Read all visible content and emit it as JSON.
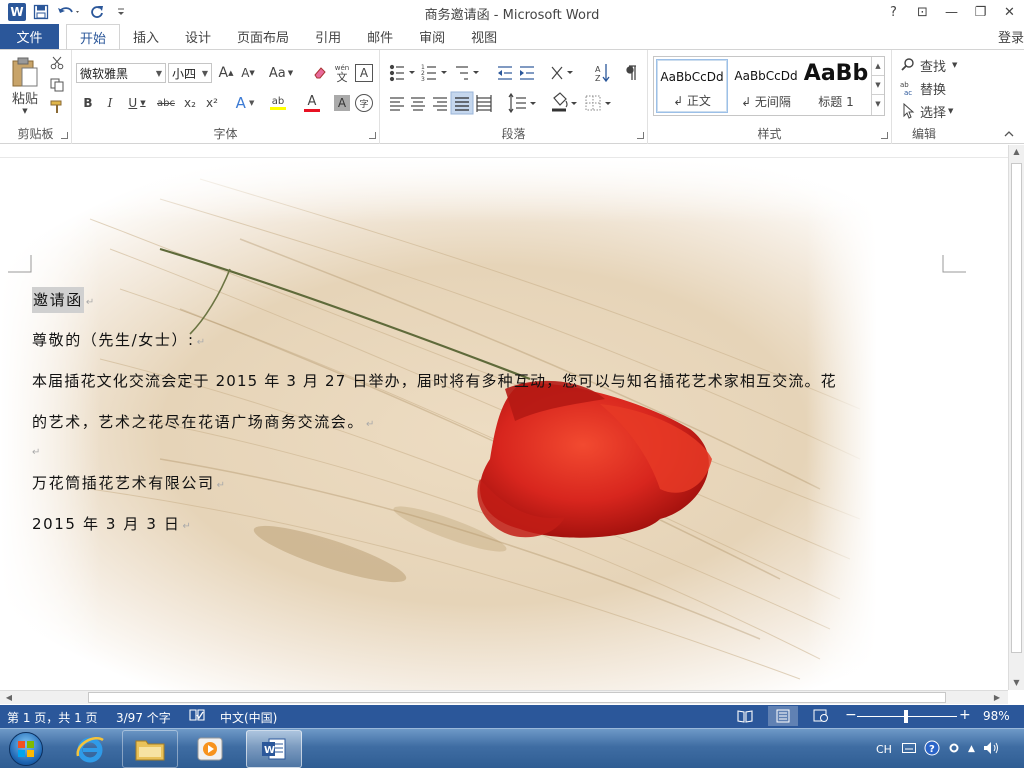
{
  "window": {
    "title": "商务邀请函 - Microsoft Word",
    "controls": [
      "?",
      "⊡",
      "—",
      "❐",
      "✕"
    ],
    "login": "登录"
  },
  "qat": {
    "logo": "W"
  },
  "tabs": {
    "file": "文件",
    "items": [
      "开始",
      "插入",
      "设计",
      "页面布局",
      "引用",
      "邮件",
      "审阅",
      "视图"
    ]
  },
  "ribbon": {
    "clipboard": {
      "label": "剪贴板",
      "paste": "粘贴"
    },
    "font": {
      "label": "字体",
      "name": "微软雅黑",
      "size": "小四",
      "grow": "A",
      "shrink": "A",
      "case": "Aa",
      "phonetic": "wén",
      "border_char": "A",
      "bold": "B",
      "italic": "I",
      "underline": "U",
      "strike": "abc",
      "sub": "x₂",
      "sup": "x²",
      "effect": "A",
      "highlight": "ab",
      "color": "A",
      "shade": "A",
      "enclose": "字"
    },
    "paragraph": {
      "label": "段落"
    },
    "styles": {
      "label": "样式",
      "items": [
        {
          "sample": "AaBbCcDd",
          "name": "↲ 正文"
        },
        {
          "sample": "AaBbCcDd",
          "name": "↲ 无间隔"
        },
        {
          "sample": "AaBb",
          "name": "标题 1"
        }
      ]
    },
    "editing": {
      "label": "编辑",
      "find": "查找",
      "replace": "替换",
      "select": "选择"
    }
  },
  "document": {
    "title": "邀请函",
    "greeting": "尊敬的（先生/女士）:",
    "body_line1": "本届插花文化交流会定于 2015 年 3 月 27 日举办，届时将有多种互动，您可以与知名插花艺术家相互交流。花",
    "body_line2": "的艺术，艺术之花尽在花语广场商务交流会。",
    "company": "万花筒插花艺术有限公司",
    "date": "2015 年 3 月 3 日",
    "para_mark": "↵"
  },
  "status": {
    "page": "第 1 页，共 1 页",
    "words": "3/97 个字",
    "language": "中文(中国)",
    "zoom": "98%",
    "zoom_level": 0.49
  },
  "taskbar": {
    "tray_lang": "CH"
  },
  "colors": {
    "accent": "#2b579a",
    "poppy": "#d8261e"
  }
}
